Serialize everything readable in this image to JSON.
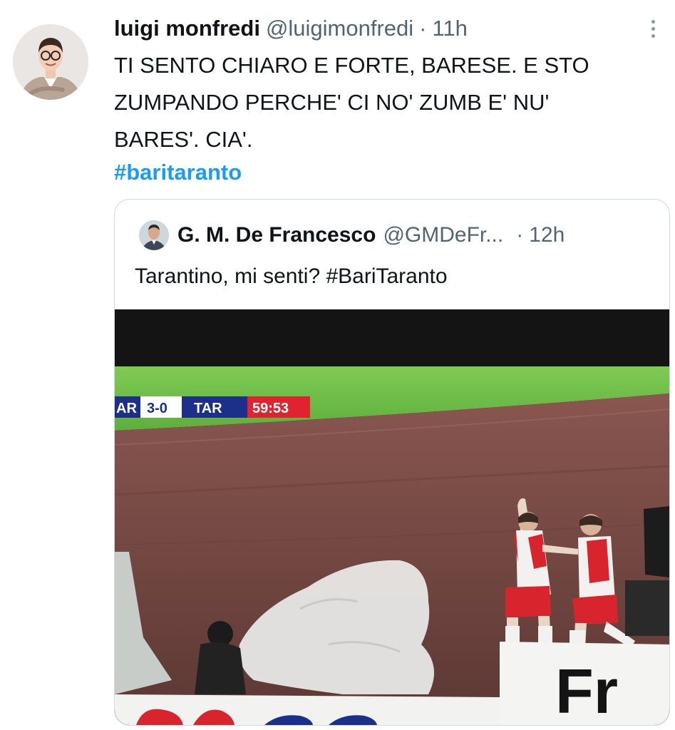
{
  "tweet": {
    "display_name": "luigi monfredi",
    "handle": "@luigimonfredi",
    "separator": "·",
    "time": "11h",
    "text_lines": [
      "TI SENTO CHIARO E FORTE, BARESE. E STO",
      "ZUMPANDO PERCHE' CI NO' ZUMB E' NU'",
      "BARES'. CIA'."
    ],
    "hashtag": "#baritaranto",
    "more_icon": "more-vertical-icon"
  },
  "quoted_tweet": {
    "display_name": "G. M. De Francesco",
    "handle": "@GMDeFr...",
    "separator": "·",
    "time": "12h",
    "text": "Tarantino, mi senti? #BariTaranto",
    "media": {
      "scoreboard": {
        "home": "AR",
        "score": "3-0",
        "away": "TAR",
        "clock": "59:53"
      },
      "billboard_text": "Fr",
      "colors": {
        "pitch": "#6fbf4a",
        "track": "#7a4a45",
        "score_blue": "#1c2f8a",
        "clock_red": "#e0232e",
        "kit_red": "#d8242c"
      }
    }
  }
}
